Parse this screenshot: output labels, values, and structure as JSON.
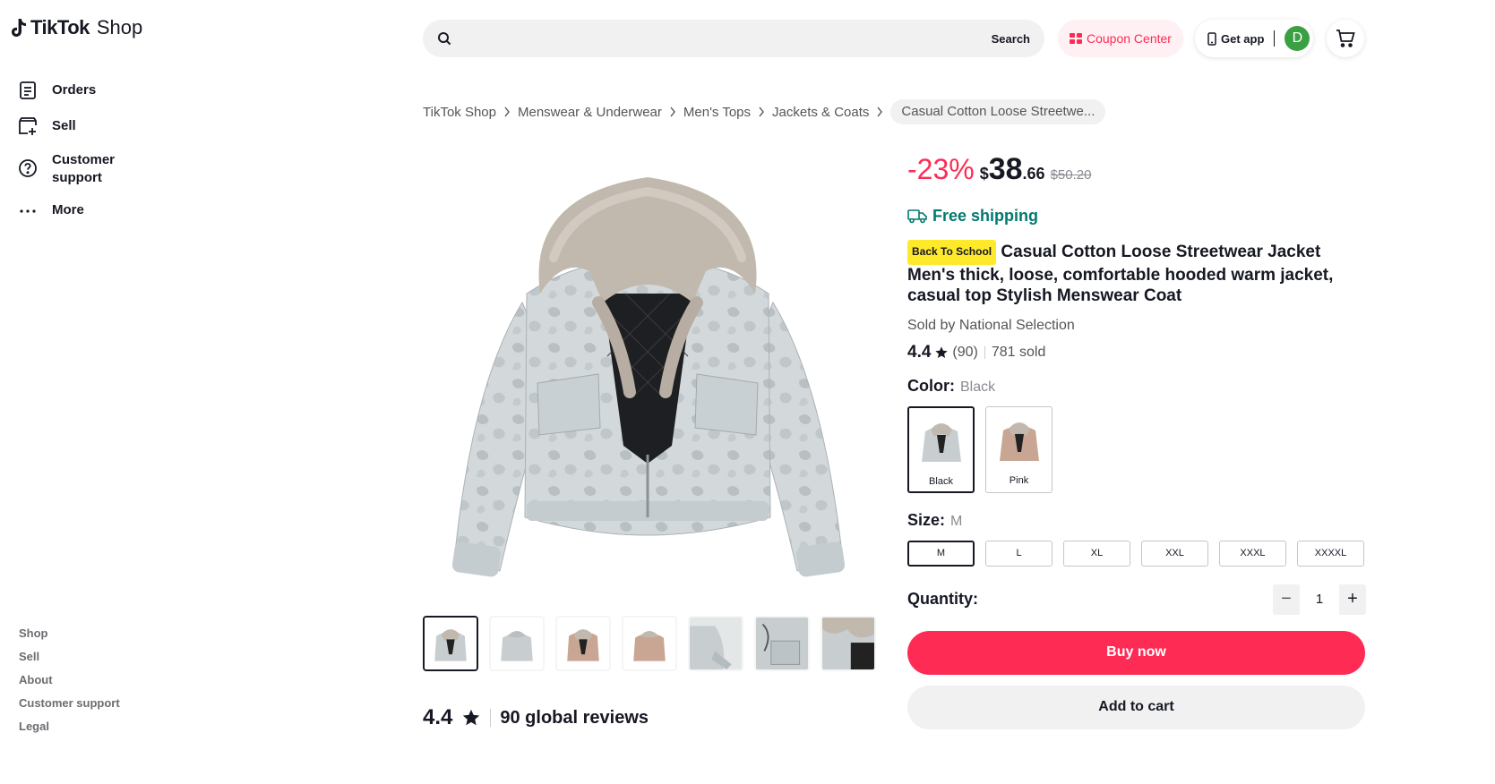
{
  "app": {
    "brand": "TikTok",
    "brand_suffix": "Shop"
  },
  "sidebar": {
    "items": [
      {
        "label": "Orders",
        "icon": "orders-icon"
      },
      {
        "label": "Sell",
        "icon": "sell-icon"
      },
      {
        "label": "Customer support",
        "icon": "help-icon"
      },
      {
        "label": "More",
        "icon": "more-icon"
      }
    ],
    "footer": [
      "Shop",
      "Sell",
      "About",
      "Customer support",
      "Legal"
    ]
  },
  "header": {
    "search_placeholder": "",
    "search_button": "Search",
    "coupon_label": "Coupon Center",
    "get_app_label": "Get app",
    "avatar_initial": "D"
  },
  "breadcrumb": [
    "TikTok Shop",
    "Menswear & Underwear",
    "Men's Tops",
    "Jackets & Coats",
    "Casual Cotton Loose Streetwe..."
  ],
  "product": {
    "discount": "-23%",
    "currency": "$",
    "price_int": "38",
    "price_dec": ".66",
    "original_price": "$50.20",
    "shipping": "Free shipping",
    "badge": "Back To School",
    "title": "Casual Cotton Loose Streetwear Jacket Men's thick, loose, comfortable hooded warm jacket, casual top Stylish Menswear Coat",
    "seller": "Sold by National Selection",
    "rating": "4.4",
    "rating_count": "(90)",
    "sold": "781 sold",
    "color_label": "Color:",
    "color_selected": "Black",
    "colors": [
      "Black",
      "Pink"
    ],
    "size_label": "Size:",
    "size_selected": "M",
    "sizes": [
      "M",
      "L",
      "XL",
      "XXL",
      "XXXL",
      "XXXXL"
    ],
    "quantity_label": "Quantity:",
    "quantity": "1",
    "buy_now": "Buy now",
    "add_to_cart": "Add to cart"
  },
  "reviews": {
    "rating": "4.4",
    "summary": "90 global reviews"
  },
  "colors": {
    "accent": "#fe2c55",
    "shipping": "#00796f",
    "badge": "#ffe92b",
    "jacket_grey": "#c8ced0",
    "jacket_pink": "#c9a593"
  }
}
